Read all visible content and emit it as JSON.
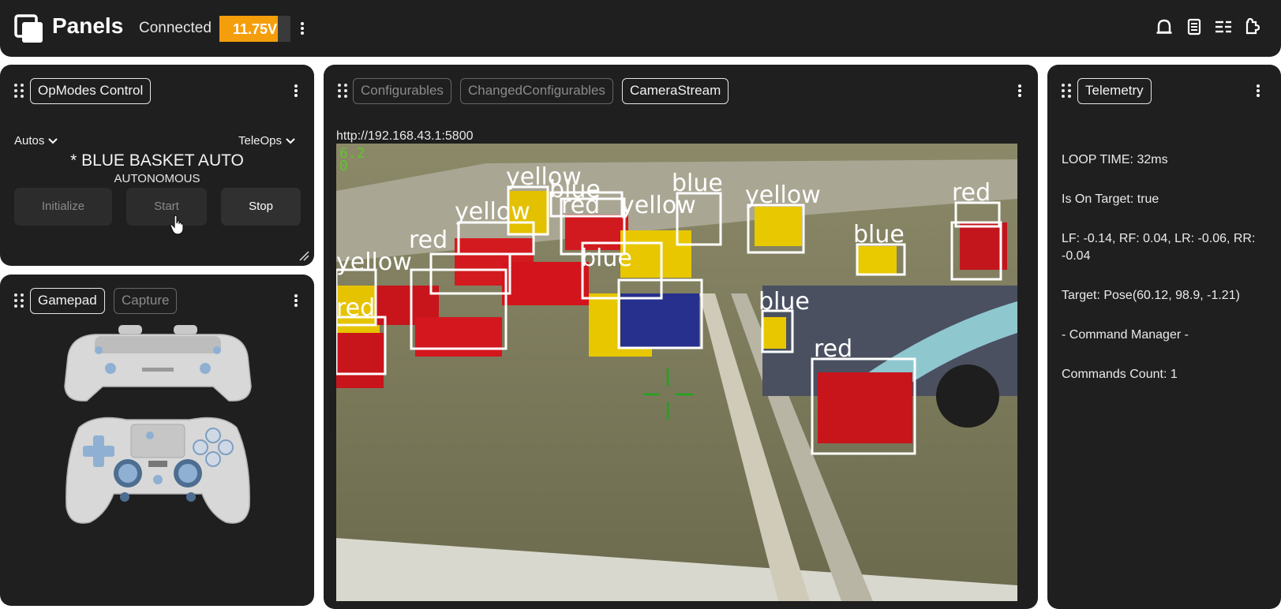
{
  "topbar": {
    "app_name": "Panels",
    "status": "Connected",
    "battery": {
      "label": "11.75V",
      "fill_fraction": 0.82,
      "color": "#f59e0b"
    },
    "icons": [
      "menu-kebab-icon",
      "notification-bell-icon",
      "document-icon",
      "list-settings-icon",
      "plugin-icon"
    ]
  },
  "opmodes": {
    "tab": "OpModes Control",
    "autos_label": "Autos",
    "teleops_label": "TeleOps",
    "selected": "* BLUE BASKET AUTO",
    "type": "AUTONOMOUS",
    "buttons": {
      "init": "Initialize",
      "start": "Start",
      "stop": "Stop"
    }
  },
  "gamepad": {
    "tabs": {
      "gamepad": "Gamepad",
      "capture": "Capture"
    }
  },
  "camera": {
    "tabs": {
      "configurables": "Configurables",
      "changed": "ChangedConfigurables",
      "stream": "CameraStream"
    },
    "url": "http://192.168.43.1:5800",
    "overlay": {
      "fps": "6.2",
      "count": "0"
    },
    "detections": {
      "yellow_1": "yellow",
      "blue_1": "blue",
      "red_1": "red",
      "yellow_2": "yellow",
      "blue_2": "blue",
      "yellow_3": "yellow",
      "blue_3": "blue",
      "red_2": "red",
      "yellow_4": "yellow",
      "red_3": "red",
      "yellow_5": "yellow",
      "blue_4": "blue",
      "red_4": "red",
      "blue_5": "blue",
      "red_5": "red"
    }
  },
  "telemetry": {
    "tab": "Telemetry",
    "lines": {
      "loop": "LOOP TIME: 32ms",
      "target": "Is On Target: true",
      "motors": "LF: -0.14, RF: 0.04, LR: -0.06, RR: -0.04",
      "pose": "Target: Pose(60.12, 98.9, -1.21)",
      "cmd": "- Command Manager -",
      "count": "Commands Count: 1"
    }
  }
}
